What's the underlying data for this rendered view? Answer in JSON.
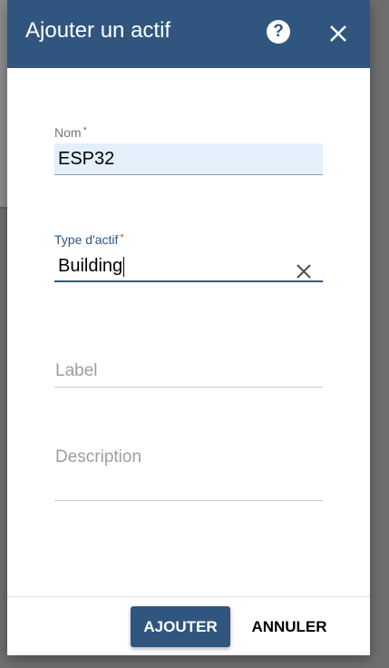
{
  "dialog": {
    "title": "Ajouter un actif",
    "help_icon": "help-circle-icon",
    "help_glyph": "?",
    "close_icon": "close-icon"
  },
  "form": {
    "name": {
      "label": "Nom",
      "required_mark": "*",
      "value": "ESP32"
    },
    "asset_type": {
      "label": "Type d'actif",
      "required_mark": "*",
      "value": "Building",
      "clear_icon": "clear-icon"
    },
    "label": {
      "placeholder": "Label",
      "value": ""
    },
    "description": {
      "placeholder": "Description",
      "value": ""
    }
  },
  "actions": {
    "add_label": "AJOUTER",
    "cancel_label": "ANNULER"
  },
  "colors": {
    "primary": "#305680",
    "required_active": "#e53935",
    "filled_background": "#e3f0fb"
  }
}
